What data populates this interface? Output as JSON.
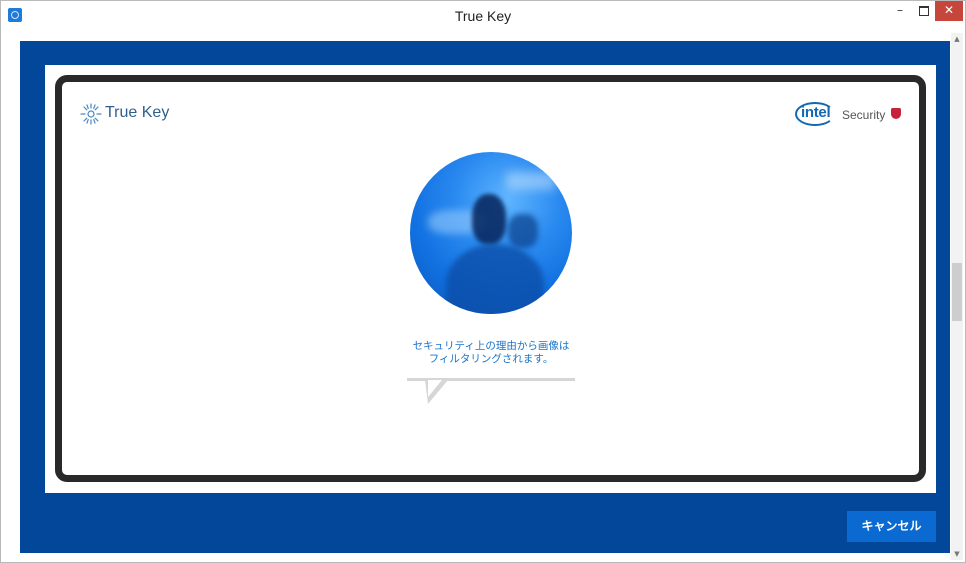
{
  "window": {
    "title": "True Key",
    "minimize_glyph": "–",
    "close_glyph": "✕"
  },
  "brand": {
    "truekey_text": "True Key",
    "intel_text": "intel",
    "security_text": "Security"
  },
  "verification": {
    "message_line1": "セキュリティ上の理由から画像は",
    "message_line2": "フィルタリングされます。"
  },
  "actions": {
    "cancel_label": "キャンセル"
  },
  "colors": {
    "client_background": "#02479a",
    "frame_border": "#292929",
    "accent_blue": "#0a6ad1",
    "message_text": "#1a74c8",
    "close_button": "#c7463c"
  },
  "icons": [
    "app-icon",
    "minimize-icon",
    "maximize-icon",
    "close-icon",
    "truekey-logo-icon",
    "intel-logo",
    "security-shield-icon",
    "scroll-up-arrow-icon",
    "scroll-down-arrow-icon"
  ]
}
